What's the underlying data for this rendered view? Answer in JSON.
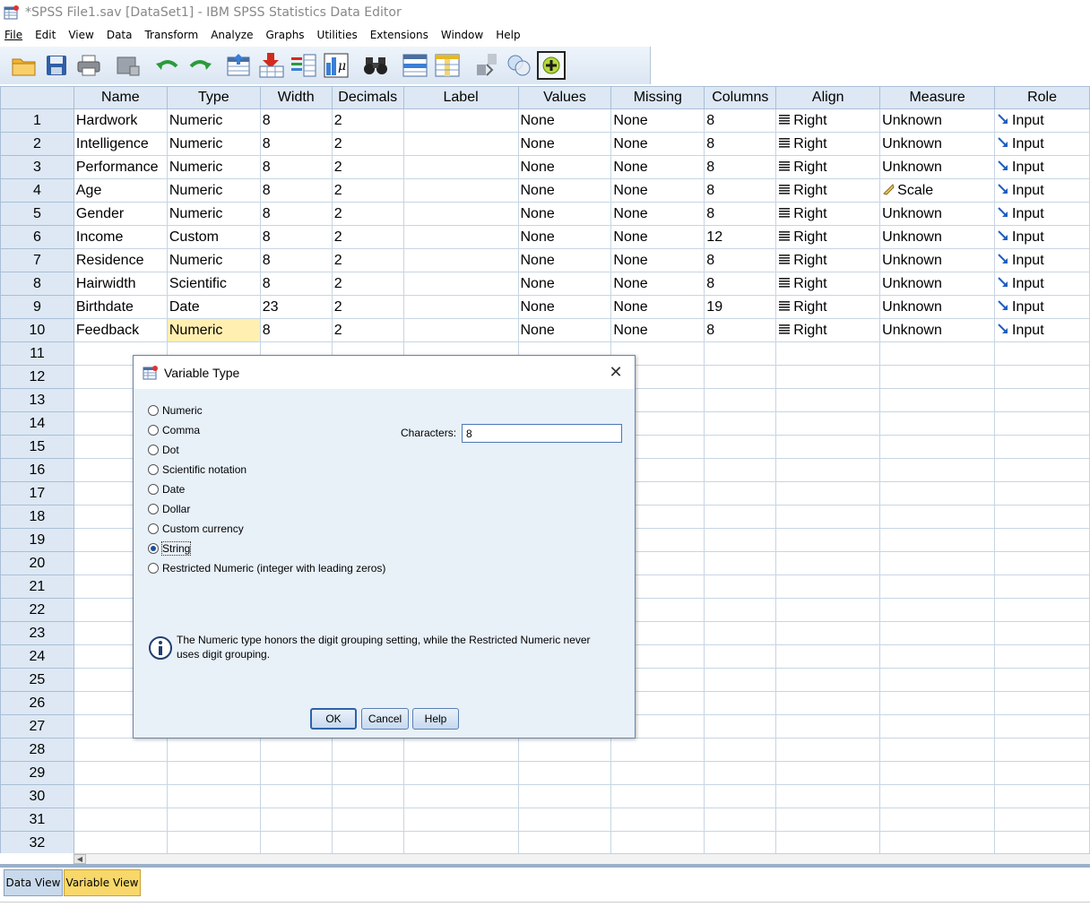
{
  "window": {
    "title": "*SPSS File1.sav [DataSet1] - IBM SPSS Statistics Data Editor"
  },
  "menu": [
    "File",
    "Edit",
    "View",
    "Data",
    "Transform",
    "Analyze",
    "Graphs",
    "Utilities",
    "Extensions",
    "Window",
    "Help"
  ],
  "grid": {
    "headers": [
      "",
      "Name",
      "Type",
      "Width",
      "Decimals",
      "Label",
      "Values",
      "Missing",
      "Columns",
      "Align",
      "Measure",
      "Role"
    ],
    "rows": [
      {
        "num": "1",
        "name": "Hardwork",
        "type": "Numeric",
        "width": "8",
        "decimals": "2",
        "label": "",
        "values": "None",
        "missing": "None",
        "columns": "8",
        "align": "Right",
        "measure": "Unknown",
        "role": "Input"
      },
      {
        "num": "2",
        "name": "Intelligence",
        "type": "Numeric",
        "width": "8",
        "decimals": "2",
        "label": "",
        "values": "None",
        "missing": "None",
        "columns": "8",
        "align": "Right",
        "measure": "Unknown",
        "role": "Input"
      },
      {
        "num": "3",
        "name": "Performance",
        "type": "Numeric",
        "width": "8",
        "decimals": "2",
        "label": "",
        "values": "None",
        "missing": "None",
        "columns": "8",
        "align": "Right",
        "measure": "Unknown",
        "role": "Input"
      },
      {
        "num": "4",
        "name": "Age",
        "type": "Numeric",
        "width": "8",
        "decimals": "2",
        "label": "",
        "values": "None",
        "missing": "None",
        "columns": "8",
        "align": "Right",
        "measure": "Scale",
        "role": "Input"
      },
      {
        "num": "5",
        "name": "Gender",
        "type": "Numeric",
        "width": "8",
        "decimals": "2",
        "label": "",
        "values": "None",
        "missing": "None",
        "columns": "8",
        "align": "Right",
        "measure": "Unknown",
        "role": "Input"
      },
      {
        "num": "6",
        "name": "Income",
        "type": "Custom",
        "width": "8",
        "decimals": "2",
        "label": "",
        "values": "None",
        "missing": "None",
        "columns": "12",
        "align": "Right",
        "measure": "Unknown",
        "role": "Input"
      },
      {
        "num": "7",
        "name": "Residence",
        "type": "Numeric",
        "width": "8",
        "decimals": "2",
        "label": "",
        "values": "None",
        "missing": "None",
        "columns": "8",
        "align": "Right",
        "measure": "Unknown",
        "role": "Input"
      },
      {
        "num": "8",
        "name": "Hairwidth",
        "type": "Scientific",
        "width": "8",
        "decimals": "2",
        "label": "",
        "values": "None",
        "missing": "None",
        "columns": "8",
        "align": "Right",
        "measure": "Unknown",
        "role": "Input"
      },
      {
        "num": "9",
        "name": "Birthdate",
        "type": "Date",
        "width": "23",
        "decimals": "2",
        "label": "",
        "values": "None",
        "missing": "None",
        "columns": "19",
        "align": "Right",
        "measure": "Unknown",
        "role": "Input"
      },
      {
        "num": "10",
        "name": "Feedback",
        "type": "Numeric",
        "width": "8",
        "decimals": "2",
        "label": "",
        "values": "None",
        "missing": "None",
        "columns": "8",
        "align": "Right",
        "measure": "Unknown",
        "role": "Input"
      }
    ],
    "empty_rows": [
      "11",
      "12",
      "13",
      "14",
      "15",
      "16",
      "17",
      "18",
      "19",
      "20",
      "21",
      "22",
      "23",
      "24",
      "25",
      "26",
      "27",
      "28",
      "29",
      "30",
      "31",
      "32"
    ]
  },
  "tabs": {
    "data_view": "Data View",
    "variable_view": "Variable View"
  },
  "dialog": {
    "title": "Variable Type",
    "options": [
      {
        "label": "Numeric",
        "checked": false
      },
      {
        "label": "Comma",
        "checked": false
      },
      {
        "label": "Dot",
        "checked": false
      },
      {
        "label": "Scientific notation",
        "checked": false
      },
      {
        "label": "Date",
        "checked": false
      },
      {
        "label": "Dollar",
        "checked": false
      },
      {
        "label": "Custom currency",
        "checked": false
      },
      {
        "label": "String",
        "checked": true
      },
      {
        "label": "Restricted Numeric (integer with leading zeros)",
        "checked": false
      }
    ],
    "characters_label": "Characters:",
    "characters_value": "8",
    "info_text": "The Numeric type honors the digit grouping setting, while the Restricted Numeric never uses digit grouping.",
    "ok_label": "OK",
    "cancel_label": "Cancel",
    "help_label": "Help"
  },
  "colors": {
    "header_bg": "#dde8f4",
    "highlight_cell": "#fff0b2",
    "active_tab": "#f8d86a",
    "dialog_bg": "#e8f0f8"
  }
}
